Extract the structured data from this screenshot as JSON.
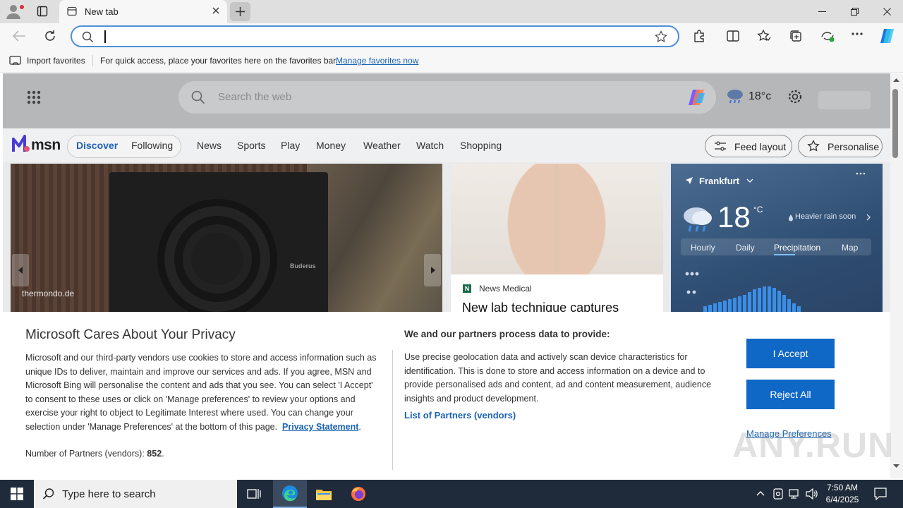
{
  "browser": {
    "tab_title": "New tab",
    "address_value": "",
    "favorites_bar": {
      "import_label": "Import favorites",
      "hint": "For quick access, place your favorites here on the favorites bar.",
      "manage_link": "Manage favorites now"
    }
  },
  "msn": {
    "search_placeholder": "Search the web",
    "weather_temp": "18°c",
    "logo_text": "msn",
    "nav": {
      "discover": "Discover",
      "following": "Following",
      "items": [
        "News",
        "Sports",
        "Play",
        "Money",
        "Weather",
        "Watch",
        "Shopping"
      ],
      "feed_layout": "Feed layout",
      "personalise": "Personalise"
    },
    "hero": {
      "source": "thermondo.de",
      "brand": "Buderus"
    },
    "card2": {
      "source": "News Medical",
      "title": "New lab technique captures"
    },
    "weather_card": {
      "location": "Frankfurt",
      "temp": "18",
      "unit": "°C",
      "alert": "Heavier rain soon",
      "tabs": [
        "Hourly",
        "Daily",
        "Precipitation",
        "Map"
      ],
      "active_tab": "Precipitation"
    }
  },
  "privacy": {
    "title": "Microsoft Cares About Your Privacy",
    "body": "Microsoft and our third-party vendors use cookies to store and access information such as unique IDs to deliver, maintain and improve our services and ads. If you agree, MSN and Microsoft Bing will personalise the content and ads that you see. You can select 'I Accept' to consent to these uses or click on 'Manage preferences' to review your options and exercise your right to object to Legitimate Interest where used.  You can change your selection under 'Manage Preferences' at the bottom of this page.",
    "privacy_link": "Privacy Statement",
    "partners_label": "Number of Partners (vendors):",
    "partners_count": "852",
    "right_title": "We and our partners process data to provide:",
    "right_body": "Use precise geolocation data and actively scan device characteristics for identification. This is done to store and access information on a device and to provide personalised ads and content, ad and content measurement, audience insights and product development.",
    "list_link": "List of Partners (vendors)",
    "accept": "I Accept",
    "reject": "Reject All",
    "manage": "Manage Preferences"
  },
  "watermark": "ANY.RUN",
  "taskbar": {
    "search_placeholder": "Type here to search",
    "time": "7:50 AM",
    "date": "6/4/2025"
  },
  "colors": {
    "accent": "#0f67c6",
    "link": "#1a63b5",
    "taskbar": "#1f2b3a"
  }
}
